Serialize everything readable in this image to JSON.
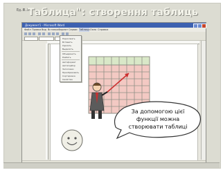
{
  "slide": {
    "title": "Таблица\": створення таблиць",
    "logo_text": "Ед.Ю.Л.",
    "bubble_text_line1": "За допомогою цієї",
    "bubble_text_line2": "функції можна",
    "bubble_text_line3": "створювати таблиці"
  },
  "word_window": {
    "title": "Документ1 - Microsoft Word",
    "menu": [
      "Файл",
      "Правка",
      "Вид",
      "Вставка",
      "Формат",
      "Сервис",
      "Таблица",
      "Окно",
      "Справка"
    ],
    "table_menu_items": [
      "Нарисовать",
      "Вставить",
      "Удалить",
      "Выделить",
      "Объединить",
      "Разбить",
      "Автоформат",
      "Автоподбор",
      "Заголовки",
      "Преобразовать",
      "Сортировка",
      "Формула",
      "Свойства"
    ]
  },
  "colors": {
    "slide_bg": "#dcdcd2",
    "grid_fill": "#f3c9c3",
    "grid_header": "#d9e8c8",
    "grid_line": "#8f8f86",
    "arrow": "#cc2f2f"
  },
  "icons": {
    "smiley": "smiley-icon",
    "teacher": "teacher-with-pointer-illustration"
  }
}
